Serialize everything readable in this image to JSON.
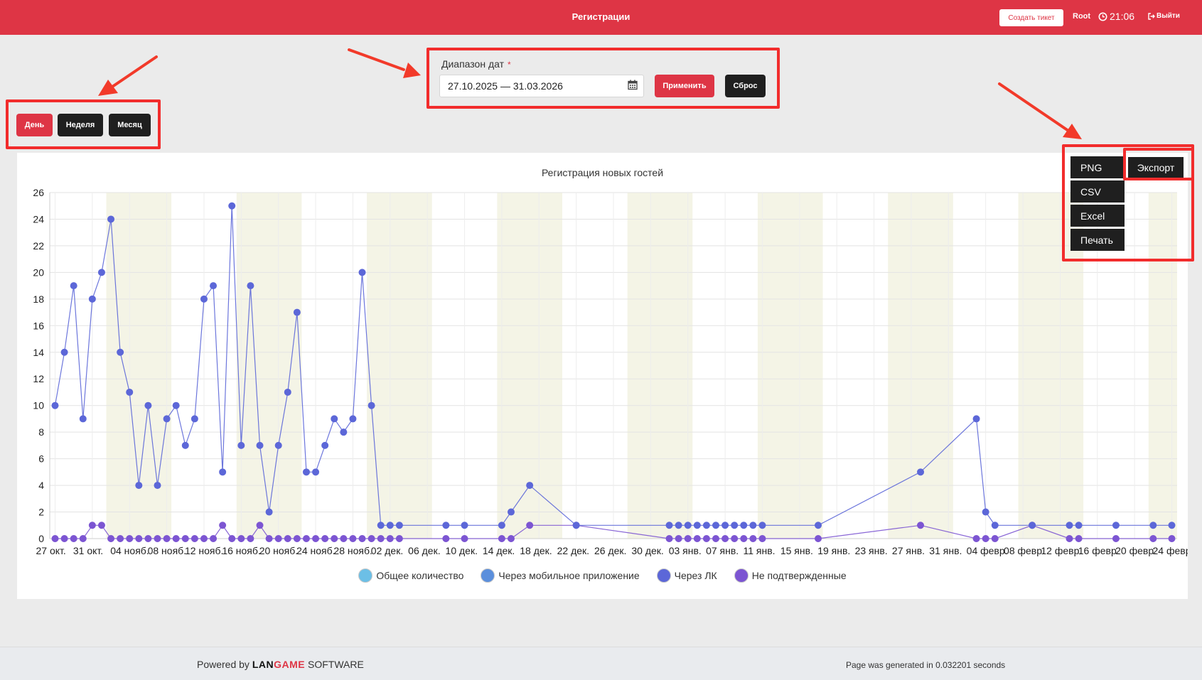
{
  "header": {
    "title": "Регистрации",
    "create_ticket": "Создать тикет",
    "user": "Root",
    "time": "21:06",
    "logout": "Выйти"
  },
  "period": {
    "day": "День",
    "week": "Неделя",
    "month": "Месяц"
  },
  "date_range": {
    "label": "Диапазон дат",
    "required_mark": "*",
    "value": "27.10.2025 — 31.03.2026",
    "apply": "Применить",
    "reset": "Сброс"
  },
  "export": {
    "main": "Экспорт",
    "png": "PNG",
    "csv": "CSV",
    "excel": "Excel",
    "print": "Печать"
  },
  "footer": {
    "powered_by": "Powered by",
    "brand_black1": "LAN",
    "brand_red": "GAME",
    "brand_suffix": "SOFTWARE",
    "generated": "Page was generated in 0.032201 seconds"
  },
  "chart_data": {
    "type": "line",
    "title": "Регистрация новых гостей",
    "xlabel": "",
    "ylabel": "",
    "ylim": [
      0,
      26
    ],
    "yticks": [
      0,
      2,
      4,
      6,
      8,
      10,
      12,
      14,
      16,
      18,
      20,
      22,
      24,
      26
    ],
    "x_start": "2025-10-27",
    "x_days": 121,
    "x_tick_labels": [
      "27 окт.",
      "31 окт.",
      "04 нояб.",
      "08 нояб.",
      "12 нояб.",
      "16 нояб.",
      "20 нояб.",
      "24 нояб.",
      "28 нояб.",
      "02 дек.",
      "06 дек.",
      "10 дек.",
      "14 дек.",
      "18 дек.",
      "22 дек.",
      "26 дек.",
      "30 дек.",
      "03 янв.",
      "07 янв.",
      "11 янв.",
      "15 янв.",
      "19 янв.",
      "23 янв.",
      "27 янв.",
      "31 янв.",
      "04 февр.",
      "08 февр.",
      "12 февр.",
      "16 февр.",
      "20 февр.",
      "24 февр."
    ],
    "grid": true,
    "legend_position": "bottom",
    "series": [
      {
        "name": "Общее количество",
        "color": "#6cbfe6",
        "points": []
      },
      {
        "name": "Через мобильное приложение",
        "color": "#5b8fdc",
        "points": []
      },
      {
        "name": "Через ЛК",
        "color": "#5c67d8",
        "points": [
          [
            0,
            10
          ],
          [
            1,
            14
          ],
          [
            2,
            19
          ],
          [
            3,
            9
          ],
          [
            4,
            18
          ],
          [
            5,
            20
          ],
          [
            6,
            24
          ],
          [
            7,
            14
          ],
          [
            8,
            11
          ],
          [
            9,
            4
          ],
          [
            10,
            10
          ],
          [
            11,
            4
          ],
          [
            12,
            9
          ],
          [
            13,
            10
          ],
          [
            14,
            7
          ],
          [
            15,
            9
          ],
          [
            16,
            18
          ],
          [
            17,
            19
          ],
          [
            18,
            5
          ],
          [
            19,
            25
          ],
          [
            20,
            7
          ],
          [
            21,
            19
          ],
          [
            22,
            7
          ],
          [
            23,
            2
          ],
          [
            24,
            7
          ],
          [
            25,
            11
          ],
          [
            26,
            17
          ],
          [
            27,
            5
          ],
          [
            28,
            5
          ],
          [
            29,
            7
          ],
          [
            30,
            9
          ],
          [
            31,
            8
          ],
          [
            32,
            9
          ],
          [
            33,
            20
          ],
          [
            34,
            10
          ],
          [
            35,
            1
          ],
          [
            36,
            1
          ],
          [
            37,
            1
          ],
          [
            42,
            1
          ],
          [
            44,
            1
          ],
          [
            48,
            1
          ],
          [
            49,
            2
          ],
          [
            51,
            4
          ],
          [
            56,
            1
          ],
          [
            66,
            1
          ],
          [
            67,
            1
          ],
          [
            68,
            1
          ],
          [
            69,
            1
          ],
          [
            70,
            1
          ],
          [
            71,
            1
          ],
          [
            72,
            1
          ],
          [
            73,
            1
          ],
          [
            74,
            1
          ],
          [
            75,
            1
          ],
          [
            76,
            1
          ],
          [
            82,
            1
          ],
          [
            93,
            5
          ],
          [
            99,
            9
          ],
          [
            100,
            2
          ],
          [
            101,
            1
          ],
          [
            105,
            1
          ],
          [
            109,
            1
          ],
          [
            110,
            1
          ],
          [
            114,
            1
          ],
          [
            118,
            1
          ],
          [
            120,
            1
          ]
        ]
      },
      {
        "name": "Не подтвержденные",
        "color": "#7c55d2",
        "points": [
          [
            0,
            0
          ],
          [
            1,
            0
          ],
          [
            2,
            0
          ],
          [
            3,
            0
          ],
          [
            4,
            1
          ],
          [
            5,
            1
          ],
          [
            6,
            0
          ],
          [
            7,
            0
          ],
          [
            8,
            0
          ],
          [
            9,
            0
          ],
          [
            10,
            0
          ],
          [
            11,
            0
          ],
          [
            12,
            0
          ],
          [
            13,
            0
          ],
          [
            14,
            0
          ],
          [
            15,
            0
          ],
          [
            16,
            0
          ],
          [
            17,
            0
          ],
          [
            18,
            1
          ],
          [
            19,
            0
          ],
          [
            20,
            0
          ],
          [
            21,
            0
          ],
          [
            22,
            1
          ],
          [
            23,
            0
          ],
          [
            24,
            0
          ],
          [
            25,
            0
          ],
          [
            26,
            0
          ],
          [
            27,
            0
          ],
          [
            28,
            0
          ],
          [
            29,
            0
          ],
          [
            30,
            0
          ],
          [
            31,
            0
          ],
          [
            32,
            0
          ],
          [
            33,
            0
          ],
          [
            34,
            0
          ],
          [
            35,
            0
          ],
          [
            36,
            0
          ],
          [
            37,
            0
          ],
          [
            42,
            0
          ],
          [
            44,
            0
          ],
          [
            48,
            0
          ],
          [
            49,
            0
          ],
          [
            51,
            1
          ],
          [
            56,
            1
          ],
          [
            66,
            0
          ],
          [
            67,
            0
          ],
          [
            68,
            0
          ],
          [
            69,
            0
          ],
          [
            70,
            0
          ],
          [
            71,
            0
          ],
          [
            72,
            0
          ],
          [
            73,
            0
          ],
          [
            74,
            0
          ],
          [
            75,
            0
          ],
          [
            76,
            0
          ],
          [
            82,
            0
          ],
          [
            93,
            1
          ],
          [
            99,
            0
          ],
          [
            100,
            0
          ],
          [
            101,
            0
          ],
          [
            105,
            1
          ],
          [
            109,
            0
          ],
          [
            110,
            0
          ],
          [
            114,
            0
          ],
          [
            118,
            0
          ],
          [
            120,
            0
          ]
        ]
      }
    ]
  }
}
